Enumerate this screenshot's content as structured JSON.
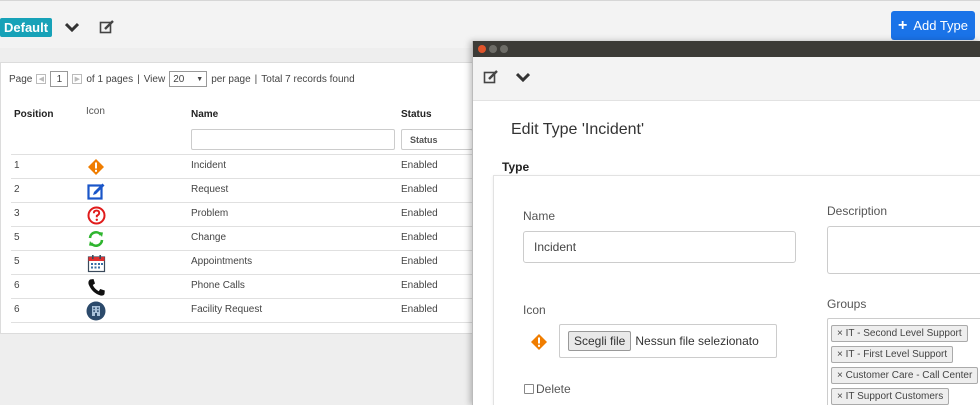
{
  "topbar": {
    "profile_badge": "Default",
    "add_type_label": "Add Type",
    "add_type_plus": "+"
  },
  "pager": {
    "page_label": "Page",
    "current_page": "1",
    "of_pages": "of 1 pages",
    "separator1": "|",
    "view_label": "View",
    "per_page_value": "20",
    "per_page_label": "per page",
    "separator2": "|",
    "total": "Total 7 records found"
  },
  "table": {
    "columns": {
      "position": "Position",
      "icon": "Icon",
      "name": "Name",
      "status": "Status"
    },
    "status_filter_placeholder": "Status",
    "rows": [
      {
        "position": "1",
        "icon": "warning-diamond-icon",
        "name": "Incident",
        "status": "Enabled"
      },
      {
        "position": "2",
        "icon": "edit-square-icon",
        "name": "Request",
        "status": "Enabled"
      },
      {
        "position": "3",
        "icon": "question-circle-icon",
        "name": "Problem",
        "status": "Enabled"
      },
      {
        "position": "5",
        "icon": "refresh-icon",
        "name": "Change",
        "status": "Enabled"
      },
      {
        "position": "5",
        "icon": "calendar-icon",
        "name": "Appointments",
        "status": "Enabled"
      },
      {
        "position": "6",
        "icon": "phone-icon",
        "name": "Phone Calls",
        "status": "Enabled"
      },
      {
        "position": "6",
        "icon": "building-icon",
        "name": "Facility Request",
        "status": "Enabled"
      }
    ]
  },
  "modal": {
    "title": "Edit Type 'Incident'",
    "section": "Type",
    "name_label": "Name",
    "name_value": "Incident",
    "description_label": "Description",
    "icon_label": "Icon",
    "choose_file_button": "Scegli file",
    "no_file_text": "Nessun file selezionato",
    "delete_label": "Delete",
    "groups_label": "Groups",
    "groups": [
      "× IT - Second Level Support",
      "× IT - First Level Support",
      "× Customer Care - Call Center",
      "× IT Support Customers"
    ]
  },
  "colors": {
    "accent_blue": "#1a73e8",
    "badge_teal": "#17a2b8",
    "titlebar": "#3c3b37"
  }
}
